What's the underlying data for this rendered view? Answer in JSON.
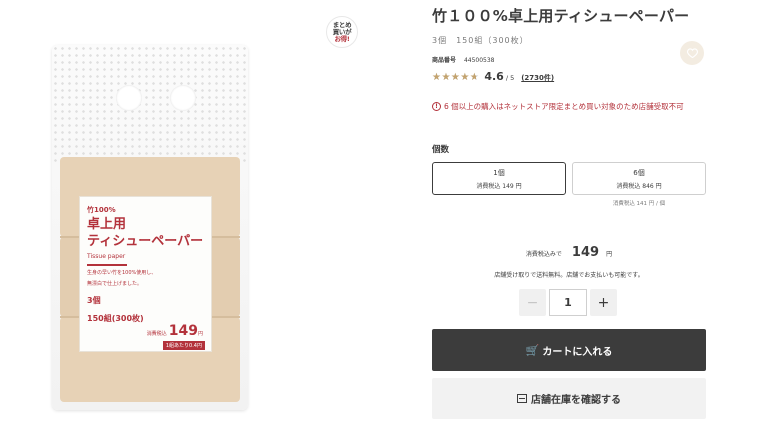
{
  "badge": {
    "line1": "まとめ",
    "line2": "買いが",
    "line3": "お得!"
  },
  "package": {
    "bamboo": "竹100%",
    "title_line1": "卓上用",
    "title_line2": "ティシューペーパー",
    "english": "Tissue paper",
    "desc_line1": "生身の早い竹を100%使用し、",
    "desc_line2": "無漂白で仕上げました。",
    "count_line1": "3個",
    "count_line2": "150組(300枚)",
    "price_label": "消費税込",
    "price": "149",
    "price_yen": "円",
    "unit_price": "1組あたり0.4円"
  },
  "product": {
    "title": "竹１００%卓上用ティシューペーパー",
    "subtitle": "3個　150組（300枚）",
    "code_label": "商品番号",
    "code_value": "44500538"
  },
  "rating": {
    "stars": "★★★★★",
    "value": 4.6,
    "score": "4.6",
    "out_of": "/ 5",
    "reviews": "(2730件)"
  },
  "warning": {
    "icon": "!",
    "text": "6 個以上の購入はネットストア限定まとめ買い対象のため店舗受取不可"
  },
  "quantity": {
    "heading": "個数",
    "options": [
      {
        "label": "1個",
        "price": "消費税込 149 円",
        "selected": true
      },
      {
        "label": "6個",
        "price": "消費税込 846 円",
        "selected": false
      }
    ],
    "per_unit_note": "消費税込 141 円 / 個"
  },
  "total": {
    "label": "消費税込みで",
    "value": "149",
    "yen": "円"
  },
  "pickup_note": "店舗受け取りで送料無料。店舗でお支払いも可能です。",
  "stepper": {
    "minus": "−",
    "value": "1",
    "plus": "+"
  },
  "buttons": {
    "cart_icon": "🛒",
    "cart": "カートに入れる",
    "store": "店舗在庫を確認する"
  },
  "icons": {
    "favorite": "heart-icon",
    "cart": "cart-icon",
    "store": "store-icon",
    "warning": "warning-icon"
  },
  "colors": {
    "accent_red": "#b3323b",
    "dark_button": "#3c3c3c",
    "star_gold": "#c3a36e",
    "favorite_bg": "#f3ece1"
  }
}
